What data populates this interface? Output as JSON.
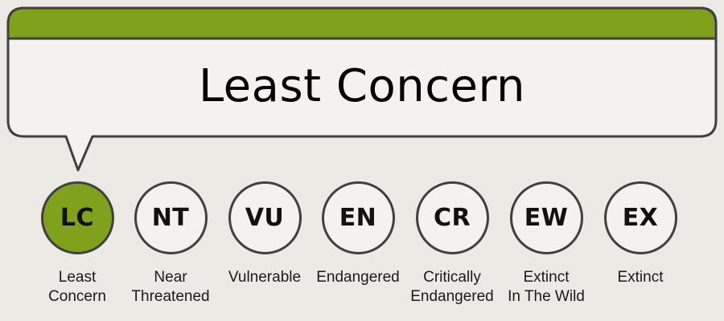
{
  "selected": {
    "title": "Least Concern"
  },
  "colors": {
    "accent": "#80a11b",
    "background": "#ede9e5",
    "bubble": "#f4f2ee",
    "outline": "#404040"
  },
  "statuses": [
    {
      "code": "LC",
      "line1": "Least",
      "line2": "Concern",
      "active": true
    },
    {
      "code": "NT",
      "line1": "Near",
      "line2": "Threatened",
      "active": false
    },
    {
      "code": "VU",
      "line1": "Vulnerable",
      "line2": "",
      "active": false
    },
    {
      "code": "EN",
      "line1": "Endangered",
      "line2": "",
      "active": false
    },
    {
      "code": "CR",
      "line1": "Critically",
      "line2": "Endangered",
      "active": false
    },
    {
      "code": "EW",
      "line1": "Extinct",
      "line2": "In The Wild",
      "active": false
    },
    {
      "code": "EX",
      "line1": "Extinct",
      "line2": "",
      "active": false
    }
  ]
}
